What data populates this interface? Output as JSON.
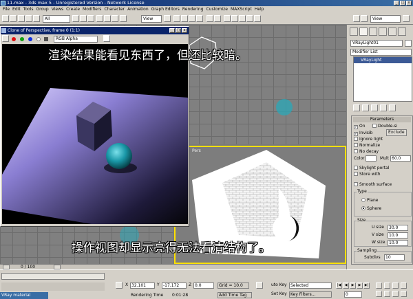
{
  "window": {
    "title": "11.max - 3ds max 5 - Unregistered Version - Network License"
  },
  "menu": [
    "File",
    "Edit",
    "Tools",
    "Group",
    "Views",
    "Create",
    "Modifiers",
    "Character",
    "Animation",
    "Graph Editors",
    "Rendering",
    "Customize",
    "MAXScript",
    "Help"
  ],
  "toolbar": {
    "selection_filter": "All",
    "ref_coord": "View",
    "right_view": "View"
  },
  "render_window": {
    "title": "Clone of Perspective, frame 0 (1:1)",
    "channel": "RGB Alpha"
  },
  "viewports": {
    "perspective_label": "Pers"
  },
  "command_panel": {
    "object_name": "VRayLight01",
    "modifier_list": "Modifier List",
    "stack_item": "VRayLight",
    "rollout_title": "Parameters",
    "on_label": "On",
    "double_sided_label": "Double-si",
    "invisible_label": "Invisib",
    "exclude_button": "Exclude",
    "ignore_light_label": "Ignore light",
    "normalize_label": "Normalize",
    "no_decay_label": "No decay",
    "color_label": "Color",
    "mult_label": "Mult",
    "mult_value": "60.0",
    "skylight_label": "Skylight portal",
    "store_label": "Store with",
    "smooth_label": "Smooth surface",
    "type_group": "Type",
    "type_plane": "Plane",
    "type_sphere": "Sphere",
    "size_group": "Size",
    "u_size_label": "U size",
    "u_size_value": "30.0",
    "v_size_label": "V size",
    "v_size_value": "10.0",
    "w_size_label": "W size",
    "w_size_value": "10.0",
    "sampling_group": "Sampling",
    "subdivs_label": "Subdivs",
    "subdivs_value": "10"
  },
  "timeline": {
    "frame": "0 / 100"
  },
  "status": {
    "x_label": "X",
    "x_value": "32.101",
    "y_label": "Y",
    "y_value": "-17.172",
    "z_label": "Z",
    "z_value": "0.0",
    "grid": "Grid = 10.0",
    "rendering_time_label": "Rendering Time",
    "rendering_time_value": "0:01:28",
    "add_time_tag": "Add Time Tag",
    "auto_key": "uto Key",
    "set_key": "Set Key",
    "key_mode": "Selected",
    "key_filters": "Key Filters...",
    "frame_field": "0",
    "taskbar": "VRay material"
  },
  "captions": {
    "top": "渲染结果能看见东西了，但还比较暗。",
    "bottom": "操作视图却显示亮得无法看清结构了。"
  },
  "colors": {
    "title_blue": "#0a246a",
    "selection_yellow": "#ffe000",
    "light_cyan": "#2aa8b8"
  }
}
